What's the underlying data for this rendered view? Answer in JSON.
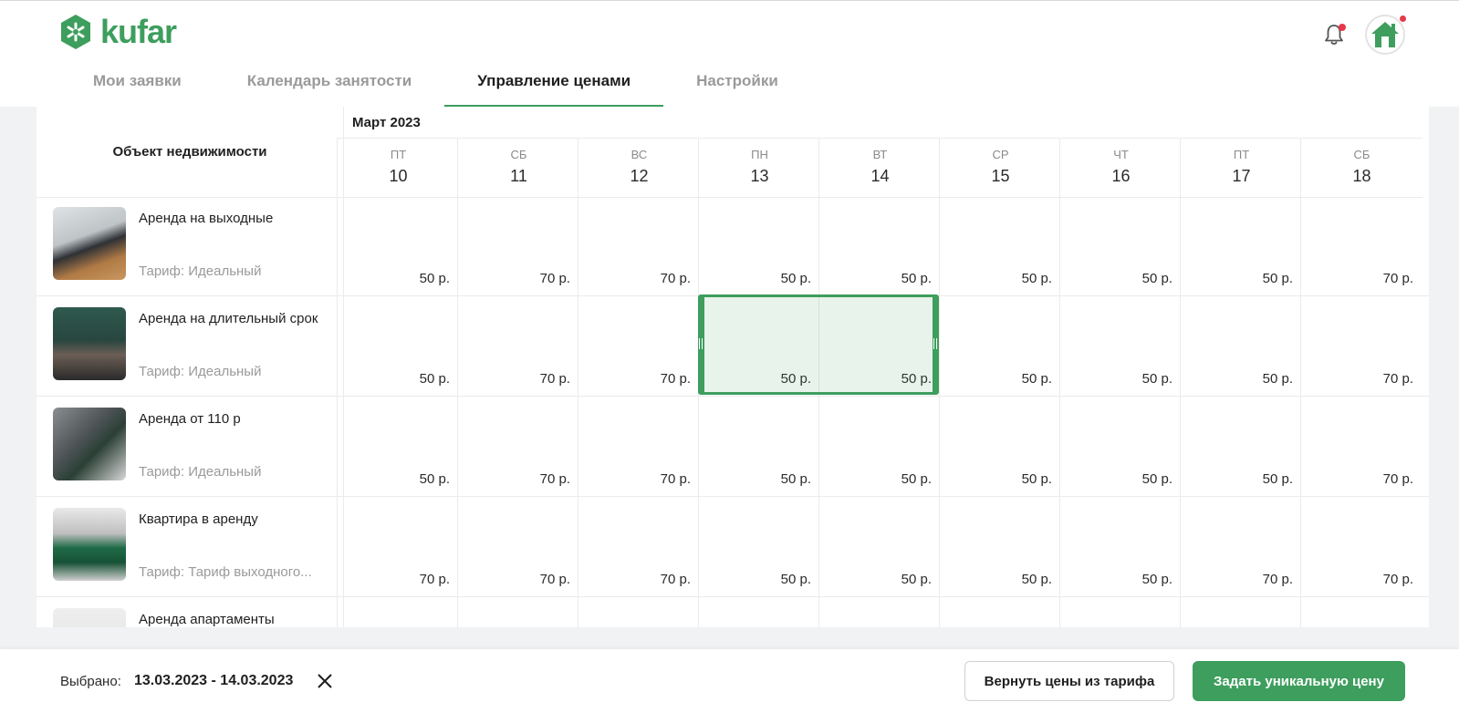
{
  "brand": {
    "name": "kufar",
    "color": "#3d9e5d"
  },
  "tabs": [
    {
      "label": "Мои заявки",
      "active": false
    },
    {
      "label": "Календарь занятости",
      "active": false
    },
    {
      "label": "Управление ценами",
      "active": true
    },
    {
      "label": "Настройки",
      "active": false
    }
  ],
  "notifications": {
    "has_unread": true
  },
  "table": {
    "property_header": "Объект недвижимости",
    "month": "Март 2023",
    "days": [
      {
        "weekday": "ПТ",
        "date": "10"
      },
      {
        "weekday": "СБ",
        "date": "11"
      },
      {
        "weekday": "ВС",
        "date": "12"
      },
      {
        "weekday": "ПН",
        "date": "13"
      },
      {
        "weekday": "ВТ",
        "date": "14"
      },
      {
        "weekday": "СР",
        "date": "15"
      },
      {
        "weekday": "ЧТ",
        "date": "16"
      },
      {
        "weekday": "ПТ",
        "date": "17"
      },
      {
        "weekday": "СБ",
        "date": "18"
      }
    ],
    "rows": [
      {
        "name": "Аренда на выходные",
        "tariff": "Тариф: Идеальный",
        "thumb": "living-room",
        "prices": [
          "50 р.",
          "70 р.",
          "70 р.",
          "50 р.",
          "50 р.",
          "50 р.",
          "50 р.",
          "50 р.",
          "70 р."
        ]
      },
      {
        "name": "Аренда на длительный срок",
        "tariff": "Тариф: Идеальный",
        "thumb": "bedroom",
        "prices": [
          "50 р.",
          "70 р.",
          "70 р.",
          "50 р.",
          "50 р.",
          "50 р.",
          "50 р.",
          "50 р.",
          "70 р."
        ]
      },
      {
        "name": "Аренда от 110 р",
        "tariff": "Тариф: Идеальный",
        "thumb": "bathroom",
        "prices": [
          "50 р.",
          "70 р.",
          "70 р.",
          "50 р.",
          "50 р.",
          "50 р.",
          "50 р.",
          "50 р.",
          "70 р."
        ]
      },
      {
        "name": "Квартира в аренду",
        "tariff": "Тариф: Тариф выходного...",
        "thumb": "green-sofa",
        "prices": [
          "70 р.",
          "70 р.",
          "70 р.",
          "50 р.",
          "50 р.",
          "50 р.",
          "50 р.",
          "70 р.",
          "70 р."
        ]
      },
      {
        "name": "Аренда апартаменты",
        "tariff": "",
        "thumb": "partial",
        "prices": [
          "",
          "",
          "",
          "",
          "",
          "",
          "",
          "",
          ""
        ]
      }
    ],
    "selected_row": 1,
    "selected_days": [
      3,
      4
    ]
  },
  "footer": {
    "selected_label": "Выбрано:",
    "selected_range": "13.03.2023 - 14.03.2023",
    "reset_button": "Вернуть цены из тарифа",
    "unique_button": "Задать уникальную цену"
  }
}
